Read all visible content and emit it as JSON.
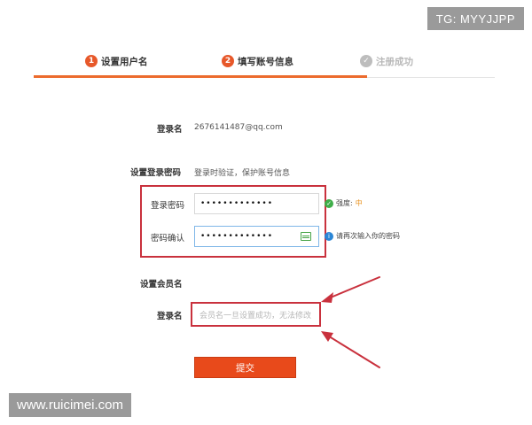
{
  "watermarks": {
    "tg": "TG: MYYJJPP",
    "site": "www.ruicimei.com"
  },
  "steps": [
    {
      "number": "1",
      "label": "设置用户名"
    },
    {
      "number": "2",
      "label": "填写账号信息"
    },
    {
      "icon": "check-icon",
      "label": "注册成功"
    }
  ],
  "login_name": {
    "label": "登录名",
    "value": "2676141487@qq.com"
  },
  "password_section": {
    "title": "设置登录密码",
    "subtitle": "登录时验证，保护账号信息"
  },
  "password": {
    "label": "登录密码",
    "value": "•••••••••••••",
    "strength_label": "强度:",
    "strength_value": "中"
  },
  "confirm": {
    "label": "密码确认",
    "value": "•••••••••••••",
    "hint": "请再次输入你的密码"
  },
  "member_section": {
    "title": "设置会员名"
  },
  "member": {
    "label": "登录名",
    "placeholder": "会员名一旦设置成功，无法修改"
  },
  "submit_label": "提交",
  "colors": {
    "accent": "#e84a1b",
    "highlight_box": "#c9313d",
    "ok": "#3fae49",
    "info": "#2a86d6"
  }
}
